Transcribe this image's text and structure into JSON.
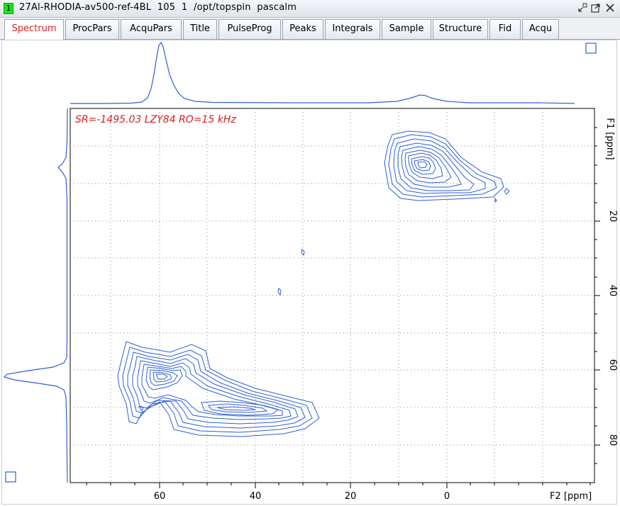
{
  "window": {
    "number": "1",
    "title": "27Al-RHODIA-av500-ref-4BL  105  1  /opt/topspin  pascalm"
  },
  "tabs": [
    {
      "label": "Spectrum",
      "active": true
    },
    {
      "label": "ProcPars",
      "active": false
    },
    {
      "label": "AcquPars",
      "active": false
    },
    {
      "label": "Title",
      "active": false
    },
    {
      "label": "PulseProg",
      "active": false
    },
    {
      "label": "Peaks",
      "active": false
    },
    {
      "label": "Integrals",
      "active": false
    },
    {
      "label": "Sample",
      "active": false
    },
    {
      "label": "Structure",
      "active": false
    },
    {
      "label": "Fid",
      "active": false
    },
    {
      "label": "Acqu",
      "active": false
    }
  ],
  "spectrum": {
    "annotation": "SR=-1495.03 LZY84 RO=15 kHz",
    "f1_label": "F1 [ppm]",
    "f2_label": "F2 [ppm]",
    "f1_ticks": [
      "20",
      "40",
      "60",
      "80"
    ],
    "f2_ticks": [
      "60",
      "40",
      "20",
      "0"
    ],
    "colors": {
      "contour": "#2f5fd6",
      "annotation": "#d42020",
      "active_tab": "#e0201f"
    }
  },
  "chart_data": {
    "type": "contour",
    "x_axis": {
      "label": "F2 [ppm]",
      "reversed": true,
      "ticks": [
        60,
        40,
        20,
        0
      ]
    },
    "y_axis": {
      "label": "F1 [ppm]",
      "ticks": [
        20,
        40,
        60,
        80
      ]
    },
    "peaks": [
      {
        "f2": 60,
        "f1": 62
      },
      {
        "f2": 45,
        "f1": 71
      },
      {
        "f2": 5,
        "f1": 13
      }
    ],
    "annotation": "SR=-1495.03 LZY84 RO=15 kHz",
    "grid": true
  }
}
